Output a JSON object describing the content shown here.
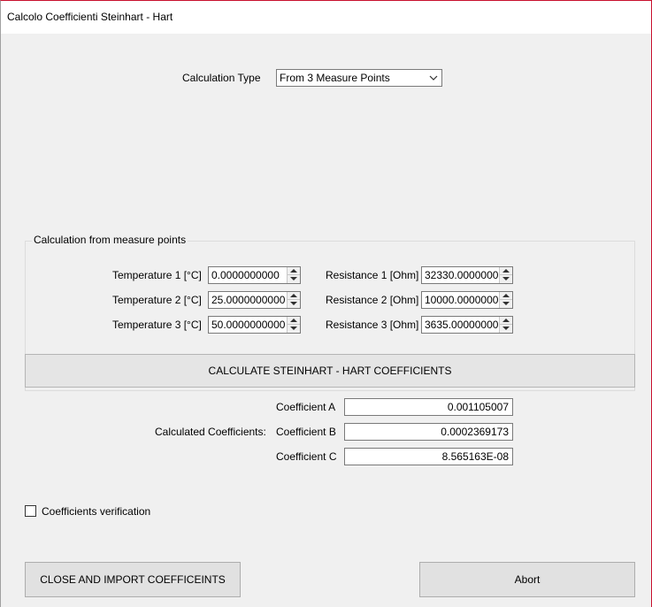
{
  "window": {
    "title": "Calcolo Coefficienti Steinhart - Hart"
  },
  "calc_type": {
    "label": "Calculation Type",
    "selected": "From 3 Measure Points"
  },
  "measure_group": {
    "title": "Calculation from measure points",
    "temperatures": [
      {
        "label": "Temperature 1 [°C]",
        "value": "0.0000000000"
      },
      {
        "label": "Temperature 2 [°C]",
        "value": "25.0000000000"
      },
      {
        "label": "Temperature 3 [°C]",
        "value": "50.0000000000"
      }
    ],
    "resistances": [
      {
        "label": "Resistance 1 [Ohm]",
        "value": "32330.0000000"
      },
      {
        "label": "Resistance 2 [Ohm]",
        "value": "10000.0000000"
      },
      {
        "label": "Resistance 3 [Ohm]",
        "value": "3635.00000000"
      }
    ]
  },
  "calculate_button": "CALCULATE STEINHART - HART COEFFICIENTS",
  "coefficients": {
    "group_label": "Calculated Coefficients:",
    "a_label": "Coefficient A",
    "a_value": "0.001105007",
    "b_label": "Coefficient B",
    "b_value": "0.0002369173",
    "c_label": "Coefficient C",
    "c_value": "8.565163E-08"
  },
  "verification": {
    "label": "Coefficients verification",
    "checked": false
  },
  "buttons": {
    "close_import": "CLOSE AND IMPORT COEFFICEINTS",
    "abort": "Abort"
  }
}
